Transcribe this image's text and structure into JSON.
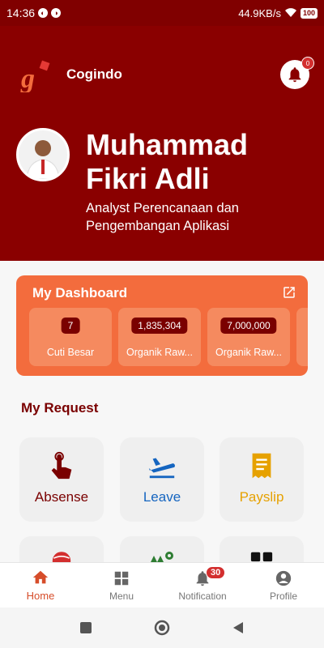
{
  "status_bar": {
    "time": "14:36",
    "network_speed": "44.9KB/s",
    "battery": "100"
  },
  "header": {
    "brand": "Cogindo",
    "notification_count": "0",
    "user_name": "Muhammad Fikri Adli",
    "user_title": "Analyst Perencanaan dan Pengembangan Aplikasi"
  },
  "dashboard": {
    "title": "My Dashboard",
    "cards": [
      {
        "value": "7",
        "label": "Cuti Besar"
      },
      {
        "value": "1,835,304",
        "label": "Organik Raw..."
      },
      {
        "value": "7,000,000",
        "label": "Organik Raw..."
      }
    ]
  },
  "requests": {
    "title": "My Request",
    "items": [
      {
        "label": "Absense",
        "color": "#7a0000",
        "icon": "touch-icon"
      },
      {
        "label": "Leave",
        "color": "#1565c0",
        "icon": "plane-icon"
      },
      {
        "label": "Payslip",
        "color": "#e6a100",
        "icon": "receipt-icon"
      }
    ]
  },
  "bottom_nav": {
    "items": [
      {
        "label": "Home",
        "icon": "home-icon",
        "active": true
      },
      {
        "label": "Menu",
        "icon": "menu-grid-icon"
      },
      {
        "label": "Notification",
        "icon": "bell-icon",
        "badge": "30"
      },
      {
        "label": "Profile",
        "icon": "person-icon"
      }
    ]
  },
  "colors": {
    "primary": "#8a0000",
    "accent": "#f36c3d",
    "active_nav": "#d64d2a"
  }
}
